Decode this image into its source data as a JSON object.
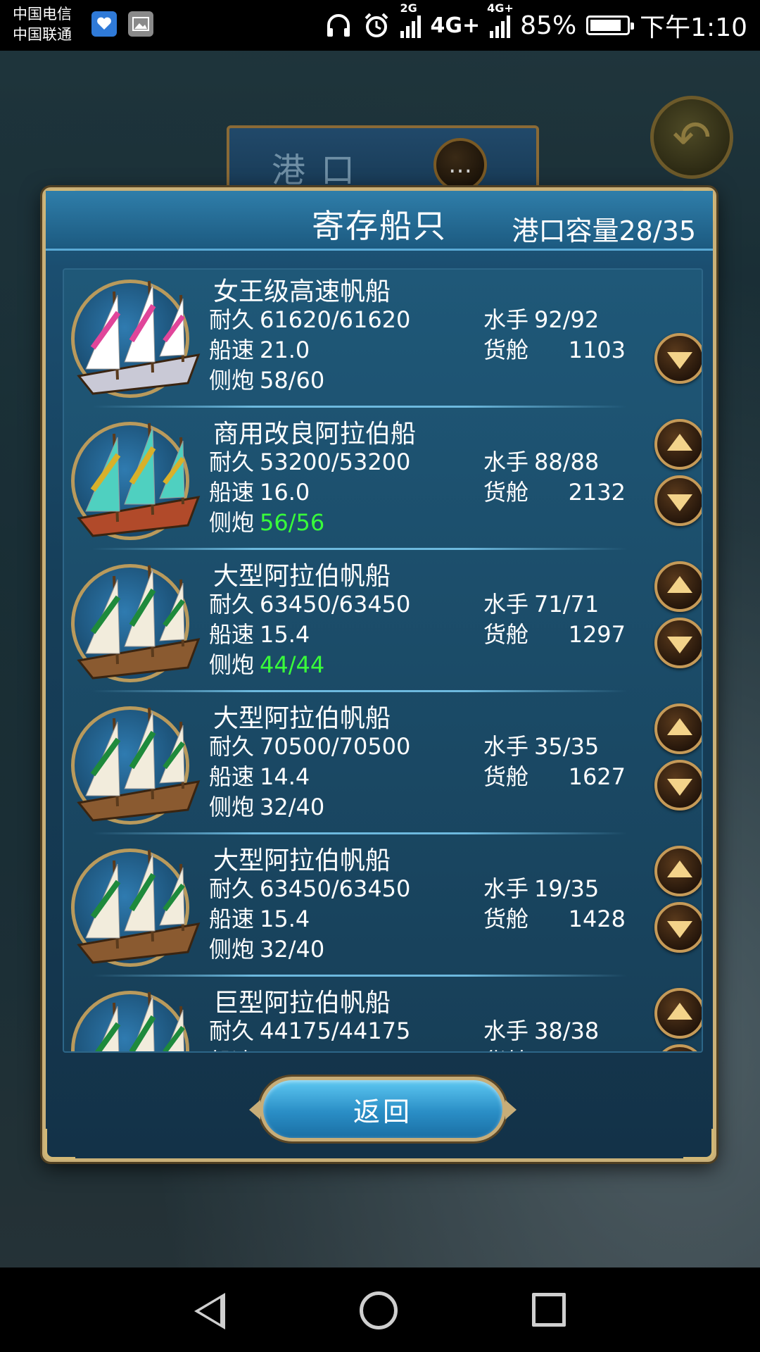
{
  "status_bar": {
    "carrier_1": "中国电信",
    "carrier_2": "中国联通",
    "network_small_1": "2G",
    "network_1": "4G+",
    "network_small_2": "4G+",
    "battery_percent": "85%",
    "battery_level": 0.85,
    "time": "下午1:10",
    "icons": [
      "health-app-icon",
      "gallery-icon",
      "headphones-icon",
      "alarm-icon",
      "signal-icon",
      "battery-icon"
    ]
  },
  "background": {
    "port_title": "港口",
    "chat_icon": "chat-bubble-icon",
    "back_icon": "back-arrow-icon"
  },
  "modal": {
    "title": "寄存船只",
    "capacity_label": "港口容量",
    "capacity_value": "28/35",
    "labels": {
      "durability": "耐久",
      "speed": "船速",
      "cannons": "侧炮",
      "sailors": "水手",
      "cargo": "货舱"
    },
    "ships": [
      {
        "name": "女王级高速帆船",
        "durability": "61620/61620",
        "speed": "21.0",
        "cannons": "58/60",
        "cannons_full": false,
        "sailors": "92/92",
        "cargo": "1103",
        "up": false,
        "down": true,
        "style": "pink"
      },
      {
        "name": "商用改良阿拉伯船",
        "durability": "53200/53200",
        "speed": "16.0",
        "cannons": "56/56",
        "cannons_full": true,
        "sailors": "88/88",
        "cargo": "2132",
        "up": true,
        "down": true,
        "style": "teal"
      },
      {
        "name": "大型阿拉伯帆船",
        "durability": "63450/63450",
        "speed": "15.4",
        "cannons": "44/44",
        "cannons_full": true,
        "sailors": "71/71",
        "cargo": "1297",
        "up": true,
        "down": true,
        "style": "green"
      },
      {
        "name": "大型阿拉伯帆船",
        "durability": "70500/70500",
        "speed": "14.4",
        "cannons": "32/40",
        "cannons_full": false,
        "sailors": "35/35",
        "cargo": "1627",
        "up": true,
        "down": true,
        "style": "green"
      },
      {
        "name": "大型阿拉伯帆船",
        "durability": "63450/63450",
        "speed": "15.4",
        "cannons": "32/40",
        "cannons_full": false,
        "sailors": "19/35",
        "cargo": "1428",
        "up": true,
        "down": true,
        "style": "green"
      },
      {
        "name": "巨型阿拉伯帆船",
        "durability": "44175/44175",
        "speed": "",
        "cannons": "",
        "cannons_full": false,
        "sailors": "38/38",
        "cargo": "",
        "up": true,
        "down": true,
        "style": "green"
      }
    ],
    "return_button": "返回"
  },
  "nav_bar": {
    "back": "nav-back-icon",
    "home": "nav-home-icon",
    "recent": "nav-recent-icon"
  }
}
